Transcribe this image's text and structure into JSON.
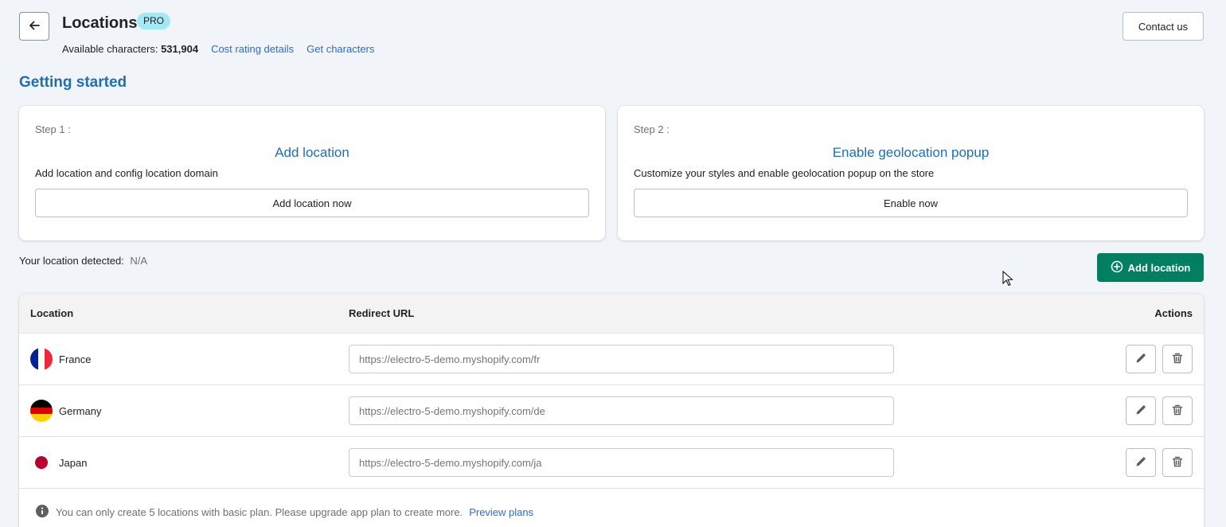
{
  "header": {
    "title": "Locations",
    "badge": "PRO",
    "available_label": "Available characters:",
    "available_value": "531,904",
    "cost_link": "Cost rating details",
    "get_link": "Get characters",
    "contact_label": "Contact us"
  },
  "getting_started": {
    "title": "Getting started",
    "steps": [
      {
        "label": "Step 1 :",
        "title": "Add location",
        "description": "Add location and config location domain",
        "button": "Add location now"
      },
      {
        "label": "Step 2 :",
        "title": "Enable geolocation popup",
        "description": "Customize your styles and enable geolocation popup on the store",
        "button": "Enable now"
      }
    ]
  },
  "detected": {
    "label": "Your location detected:",
    "value": "N/A"
  },
  "add_location_button": "Add location",
  "table": {
    "columns": [
      "Location",
      "Redirect URL",
      "Actions"
    ],
    "rows": [
      {
        "country": "France",
        "url": "https://electro-5-demo.myshopify.com/fr",
        "flag": "france-flag"
      },
      {
        "country": "Germany",
        "url": "https://electro-5-demo.myshopify.com/de",
        "flag": "germany-flag"
      },
      {
        "country": "Japan",
        "url": "https://electro-5-demo.myshopify.com/ja",
        "flag": "japan-flag"
      }
    ]
  },
  "notice": {
    "text": "You can only create 5 locations with basic plan. Please upgrade app plan to create more.",
    "link": "Preview plans"
  },
  "colors": {
    "primary": "#008060",
    "heading_blue": "#1f6fb0",
    "link_blue": "#2c6ecb",
    "badge_bg": "#a4e8f2"
  }
}
